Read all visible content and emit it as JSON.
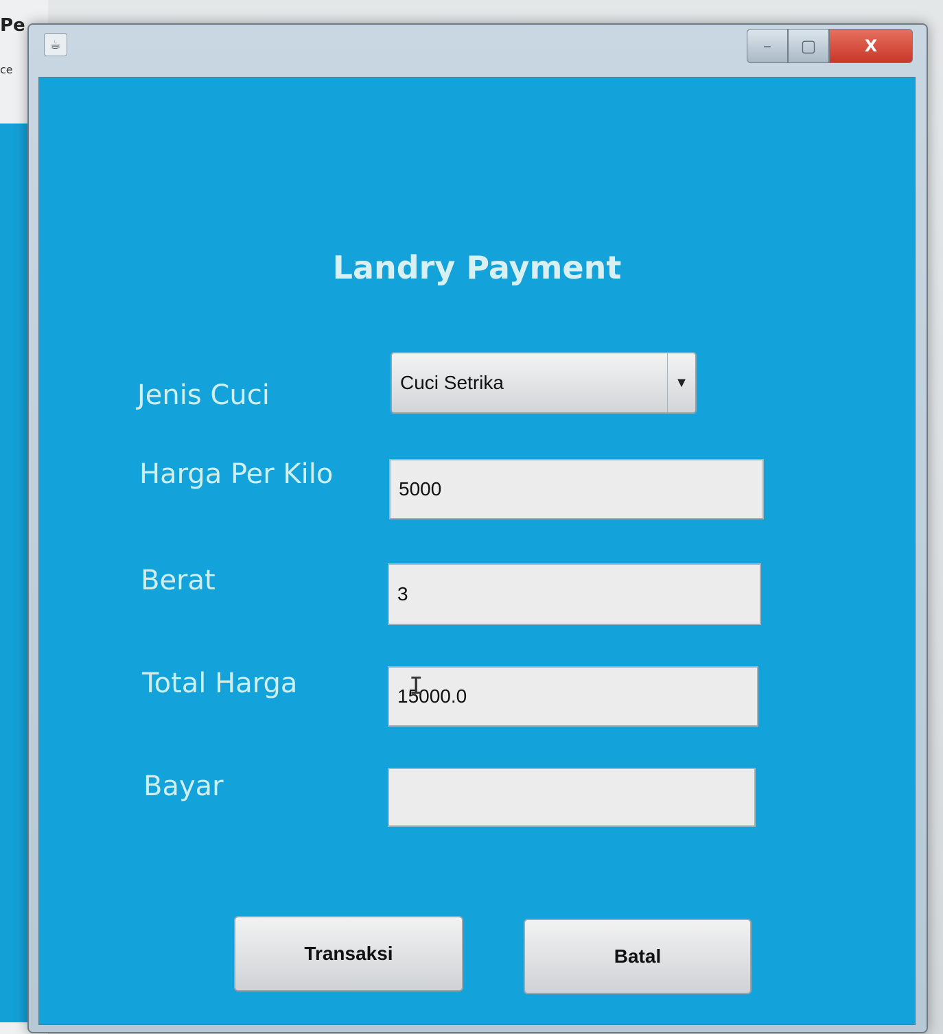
{
  "background_window": {
    "title_fragment": "Pe",
    "menu_fragment": "ce"
  },
  "window": {
    "controls": {
      "minimize": "–",
      "maximize": "▢",
      "close": "X"
    }
  },
  "form": {
    "title": "Landry Payment",
    "fields": {
      "jenis_cuci": {
        "label": "Jenis Cuci",
        "value": "Cuci Setrika"
      },
      "harga_per_kilo": {
        "label": "Harga Per Kilo",
        "value": "5000"
      },
      "berat": {
        "label": "Berat",
        "value": "3"
      },
      "total_harga": {
        "label": "Total Harga",
        "value": "15000.0"
      },
      "bayar": {
        "label": "Bayar",
        "value": ""
      }
    },
    "buttons": {
      "transaksi": "Transaksi",
      "batal": "Batal"
    }
  },
  "colors": {
    "panel_background": "#13a3da",
    "label_text": "#cfeeee",
    "close_button": "#c8372a"
  },
  "icons": {
    "app": "java-app-icon",
    "dropdown": "chevron-down-icon",
    "text_cursor": "i-beam-cursor-icon"
  }
}
